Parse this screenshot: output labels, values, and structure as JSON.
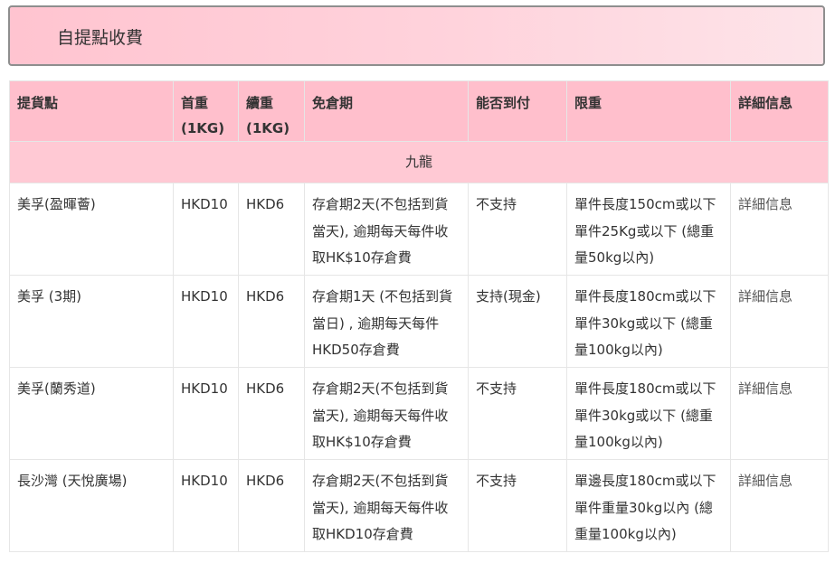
{
  "header": {
    "title": "自提點收費"
  },
  "table": {
    "columns": [
      "提貨點",
      "首重 (1KG)",
      "續重 (1KG)",
      "免倉期",
      "能否到付",
      "限重",
      "詳細信息"
    ],
    "region": "九龍",
    "rows": [
      {
        "location": "美孚(盈暉薈)",
        "first_weight": "HKD10",
        "extra_weight": "HKD6",
        "free_storage": "存倉期2天(不包括到貨當天), 逾期每天每件收取HK$10存倉費",
        "cod": "不支持",
        "weight_limit": "單件長度150cm或以下單件25Kg或以下 (總重量50kg以內)",
        "details": "詳細信息"
      },
      {
        "location": "美孚 (3期)",
        "first_weight": "HKD10",
        "extra_weight": "HKD6",
        "free_storage": "存倉期1天 (不包括到貨當日) , 逾期每天每件HKD50存倉費",
        "cod": "支持(現金)",
        "weight_limit": "單件長度180cm或以下單件30kg或以下 (總重量100kg以內)",
        "details": "詳細信息"
      },
      {
        "location": "美孚(蘭秀道)",
        "first_weight": "HKD10",
        "extra_weight": "HKD6",
        "free_storage": "存倉期2天(不包括到貨當天), 逾期每天每件收取HK$10存倉費",
        "cod": "不支持",
        "weight_limit": "單件長度180cm或以下單件30kg或以下 (總重量100kg以內)",
        "details": "詳細信息"
      },
      {
        "location": "長沙灣 (天悅廣場)",
        "first_weight": "HKD10",
        "extra_weight": "HKD6",
        "free_storage": "存倉期2天(不包括到貨當天), 逾期每天每件收取HKD10存倉費",
        "cod": "不支持",
        "weight_limit": "單邊長度180cm或以下單件重量30kg以內 (總重量100kg以內)",
        "details": "詳細信息"
      }
    ]
  },
  "colors": {
    "header_bg": "#ffbfcc",
    "region_bg": "#ffc9d4",
    "title_gradient_start": "#ffc4d0",
    "title_gradient_end": "#fde4e9"
  }
}
